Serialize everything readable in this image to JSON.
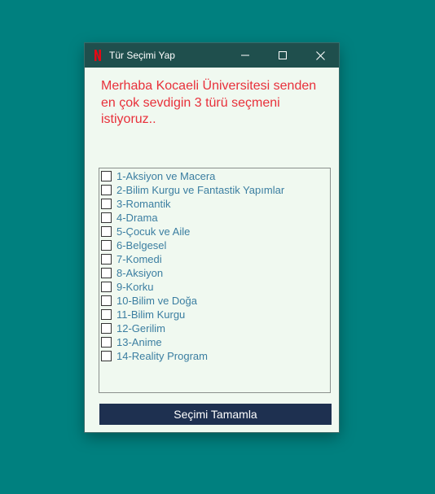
{
  "window": {
    "title": "Tür Seçimi Yap",
    "app_icon": "netflix-n-icon",
    "controls": [
      "minimize-icon",
      "maximize-icon",
      "close-icon"
    ]
  },
  "greeting": "Merhaba Kocaeli Üniversitesi senden en çok sevdigin 3 türü seçmeni istiyoruz..",
  "genres": [
    {
      "label": "1-Aksiyon ve Macera",
      "checked": false
    },
    {
      "label": "2-Bilim Kurgu ve Fantastik Yapımlar",
      "checked": false
    },
    {
      "label": "3-Romantik",
      "checked": false
    },
    {
      "label": "4-Drama",
      "checked": false
    },
    {
      "label": "5-Çocuk ve Aile",
      "checked": false
    },
    {
      "label": "6-Belgesel",
      "checked": false
    },
    {
      "label": "7-Komedi",
      "checked": false
    },
    {
      "label": "8-Aksiyon",
      "checked": false
    },
    {
      "label": "9-Korku",
      "checked": false
    },
    {
      "label": "10-Bilim ve Doğa",
      "checked": false
    },
    {
      "label": "11-Bilim Kurgu",
      "checked": false
    },
    {
      "label": "12-Gerilim",
      "checked": false
    },
    {
      "label": "13-Anime",
      "checked": false
    },
    {
      "label": "14-Reality Program",
      "checked": false
    }
  ],
  "submit_label": "Seçimi Tamamla",
  "colors": {
    "desktop": "#00807f",
    "titlebar": "#1f4f4d",
    "window_bg": "#f0f9f0",
    "greeting_text": "#e8303a",
    "item_text": "#3b7ea1",
    "button_bg": "#1e3050",
    "netflix_red": "#e50914"
  }
}
